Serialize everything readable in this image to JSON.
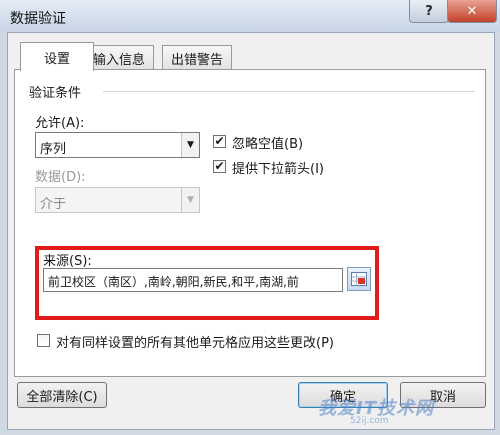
{
  "window": {
    "title": "数据验证",
    "help_glyph": "?",
    "close_glyph": "✕"
  },
  "tabs": [
    {
      "label": "设置",
      "active": true
    },
    {
      "label": "输入信息",
      "active": false
    },
    {
      "label": "出错警告",
      "active": false
    }
  ],
  "criteria": {
    "group_title": "验证条件",
    "allow_label": "允许(A):",
    "allow_value": "序列",
    "data_label": "数据(D):",
    "data_value": "介于",
    "ignore_blank": {
      "label": "忽略空值(B)",
      "checked": true
    },
    "in_cell_dropdown": {
      "label": "提供下拉箭头(I)",
      "checked": true
    },
    "source_label": "来源(S):",
    "source_value": "前卫校区（南区）,南岭,朝阳,新民,和平,南湖,前"
  },
  "apply_all": {
    "label": "对有同样设置的所有其他单元格应用这些更改(P)",
    "checked": false
  },
  "buttons": {
    "clear_all": "全部清除(C)",
    "ok": "确定",
    "cancel": "取消"
  },
  "watermark": {
    "text": "我爱IT技术网",
    "sub": "52ij.com"
  },
  "colors": {
    "highlight": "#e01b1b",
    "close_button": "#c3402a"
  }
}
